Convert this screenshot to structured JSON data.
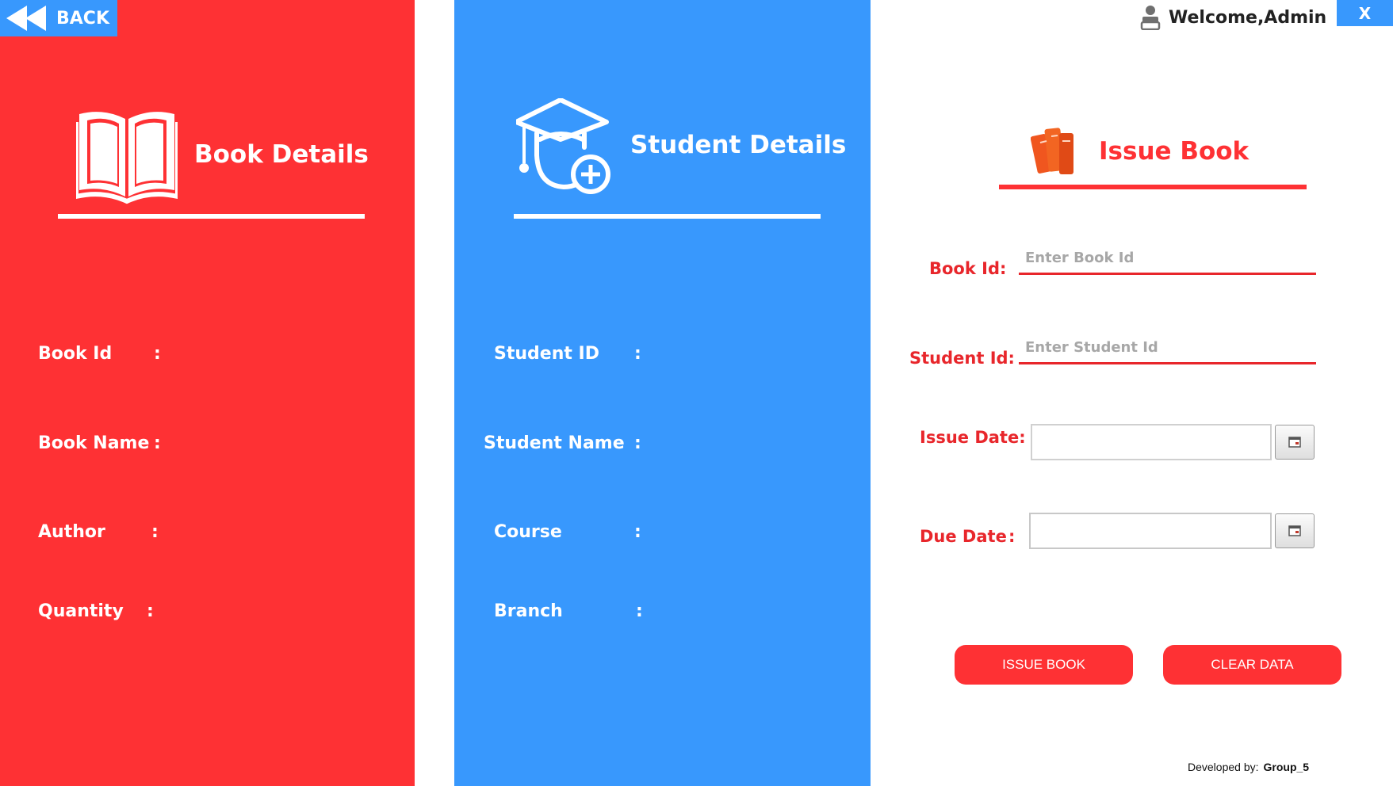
{
  "header": {
    "back_label": "BACK",
    "close_label": "X",
    "welcome_text": "Welcome,Admin"
  },
  "book_panel": {
    "title": "Book Details",
    "fields": [
      {
        "label": "Book Id"
      },
      {
        "label": "Book Name"
      },
      {
        "label": "Author"
      },
      {
        "label": "Quantity"
      }
    ],
    "colon": ":"
  },
  "student_panel": {
    "title": "Student Details",
    "fields": [
      {
        "label": "Student ID"
      },
      {
        "label": "Student Name"
      },
      {
        "label": "Course"
      },
      {
        "label": "Branch"
      }
    ],
    "colon": ":"
  },
  "issue_form": {
    "title": "Issue Book",
    "book_id_label": "Book Id:",
    "book_id_placeholder": "Enter Book Id",
    "book_id_value": "",
    "student_id_label": "Student Id:",
    "student_id_placeholder": "Enter Student Id",
    "student_id_value": "",
    "issue_date_label": "Issue Date:",
    "issue_date_value": "",
    "due_date_label": "Due Date",
    "due_date_colon": ":",
    "due_date_value": "",
    "issue_button_label": "ISSUE BOOK",
    "clear_button_label": "CLEAR DATA"
  },
  "footer": {
    "developed_by_label": "Developed by:",
    "developer": "Group_5"
  },
  "colors": {
    "book_panel_bg": "#fe3134",
    "student_panel_bg": "#3898fd",
    "accent_red": "#e8262b"
  },
  "icons": {
    "back": "rewind-icon",
    "book": "open-book-icon",
    "student": "graduate-add-icon",
    "issue": "books-stack-icon",
    "user": "user-icon",
    "calendar": "calendar-icon"
  }
}
